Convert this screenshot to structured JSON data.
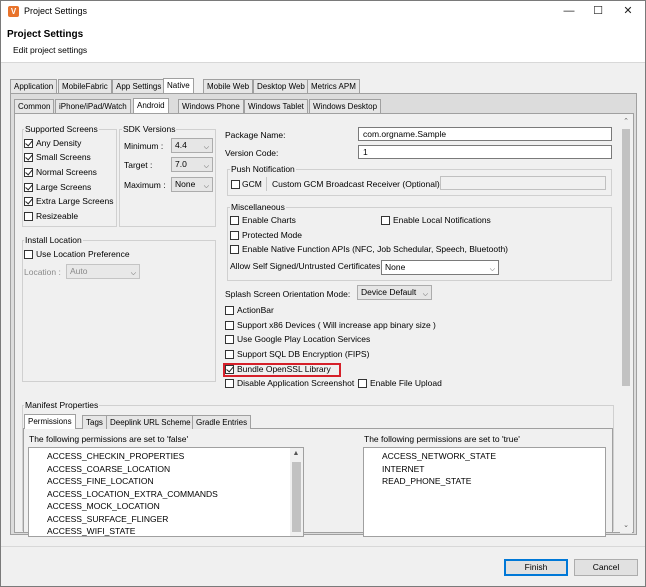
{
  "window": {
    "title": "Project Settings",
    "header_title": "Project Settings",
    "header_subtitle": "Edit project settings",
    "accent": "#e8732b"
  },
  "top_tabs": [
    "Application",
    "MobileFabric",
    "App Settings",
    "Native",
    "Mobile Web",
    "Desktop Web",
    "Metrics APM"
  ],
  "native_tabs": [
    "Common",
    "iPhone/iPad/Watch",
    "Android",
    "Windows Phone",
    "Windows Tablet",
    "Windows Desktop"
  ],
  "supported_screens": {
    "title": "Supported Screens",
    "items": [
      {
        "label": "Any Density",
        "checked": true
      },
      {
        "label": "Small Screens",
        "checked": true
      },
      {
        "label": "Normal Screens",
        "checked": true
      },
      {
        "label": "Large Screens",
        "checked": true
      },
      {
        "label": "Extra Large Screens",
        "checked": true
      },
      {
        "label": "Resizeable",
        "checked": false
      }
    ]
  },
  "sdk_versions": {
    "title": "SDK Versions",
    "minimum_label": "Minimum :",
    "minimum_value": "4.4",
    "target_label": "Target :",
    "target_value": "7.0",
    "maximum_label": "Maximum :",
    "maximum_value": "None"
  },
  "install_location": {
    "title": "Install Location",
    "use_pref_label": "Use Location Preference",
    "location_label": "Location :",
    "location_value": "Auto"
  },
  "package": {
    "name_label": "Package Name:",
    "name_value": "com.orgname.Sample",
    "version_label": "Version Code:",
    "version_value": "1"
  },
  "push": {
    "title": "Push Notification",
    "gcm_label": "GCM",
    "receiver_label": "Custom GCM Broadcast Receiver (Optional):",
    "receiver_value": ""
  },
  "misc": {
    "title": "Miscellaneous",
    "enable_charts": "Enable Charts",
    "enable_local_notifications": "Enable Local Notifications",
    "protected_mode": "Protected Mode",
    "native_apis": "Enable Native Function APIs (NFC, Job Schedular, Speech, Bluetooth)",
    "self_signed_label": "Allow Self Signed/Untrusted Certificates",
    "self_signed_value": "None"
  },
  "splash": {
    "label": "Splash Screen Orientation Mode:",
    "value": "Device Default"
  },
  "options": [
    {
      "label": "ActionBar",
      "checked": false
    },
    {
      "label": "Support x86 Devices   ( Will increase app binary size )",
      "checked": false
    },
    {
      "label": "Use Google Play Location Services",
      "checked": false
    },
    {
      "label": "Support SQL DB Encryption (FIPS)",
      "checked": false
    },
    {
      "label": "Bundle OpenSSL Library",
      "checked": true
    }
  ],
  "disable_screenshot": "Disable Application Screenshot",
  "enable_file_upload": "Enable File Upload",
  "manifest": {
    "title": "Manifest Properties",
    "tabs": [
      "Permissions",
      "Tags",
      "Deeplink URL Scheme",
      "Gradle Entries"
    ],
    "false_label": "The following permissions are set to 'false'",
    "true_label": "The following permissions are set to 'true'",
    "false_permissions": [
      "ACCESS_CHECKIN_PROPERTIES",
      "ACCESS_COARSE_LOCATION",
      "ACCESS_FINE_LOCATION",
      "ACCESS_LOCATION_EXTRA_COMMANDS",
      "ACCESS_MOCK_LOCATION",
      "ACCESS_SURFACE_FLINGER",
      "ACCESS_WIFI_STATE"
    ],
    "true_permissions": [
      "ACCESS_NETWORK_STATE",
      "INTERNET",
      "READ_PHONE_STATE"
    ]
  },
  "buttons": {
    "finish": "Finish",
    "cancel": "Cancel"
  }
}
